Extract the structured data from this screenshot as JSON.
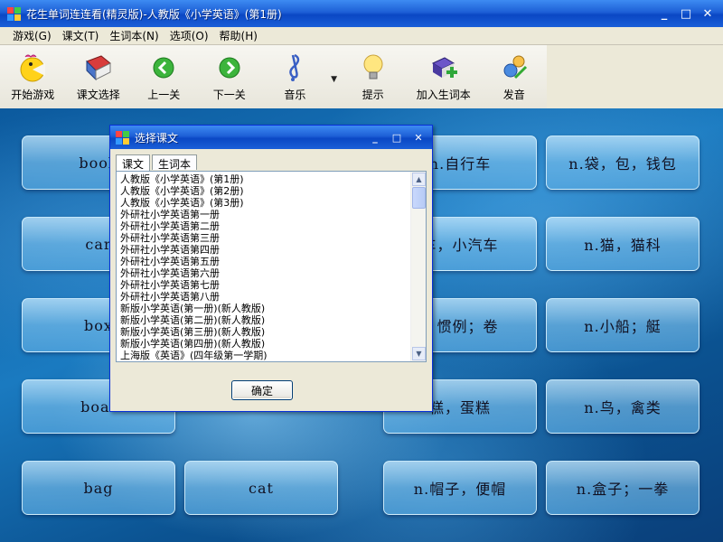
{
  "window": {
    "title": "花生单词连连看(精灵版)-人教版《小学英语》(第1册)",
    "buttons": [
      "_",
      "□",
      "✕"
    ]
  },
  "menu": [
    {
      "label": "游戏(G)"
    },
    {
      "label": "课文(T)"
    },
    {
      "label": "生词本(N)"
    },
    {
      "label": "选项(O)"
    },
    {
      "label": "帮助(H)"
    }
  ],
  "toolbar": [
    {
      "label": "开始游戏",
      "icon": "pacman-icon"
    },
    {
      "label": "课文选择",
      "icon": "book-icon"
    },
    {
      "label": "上一关",
      "icon": "arrow-left-icon"
    },
    {
      "label": "下一关",
      "icon": "arrow-right-icon"
    },
    {
      "label": "音乐",
      "icon": "music-note-icon"
    },
    {
      "label": "提示",
      "icon": "lightbulb-icon"
    },
    {
      "label": "加入生词本",
      "icon": "add-book-icon"
    },
    {
      "label": "发音",
      "icon": "speaker-person-icon"
    }
  ],
  "cards": [
    {
      "text": "book"
    },
    {
      "text": "n.自行车"
    },
    {
      "text": "n.袋，包，钱包"
    },
    {
      "text": "car"
    },
    {
      "text": "车，小汽车"
    },
    {
      "text": "n.猫，猫科"
    },
    {
      "text": "box"
    },
    {
      "text": "；惯例；卷"
    },
    {
      "text": "n.小船；艇"
    },
    {
      "text": "boat"
    },
    {
      "text": "糕，蛋糕"
    },
    {
      "text": "n.鸟，禽类"
    },
    {
      "text": "bag"
    },
    {
      "text": "cat"
    },
    {
      "text": "n.帽子，便帽"
    },
    {
      "text": "n.盒子；一拳"
    }
  ],
  "dialog": {
    "title": "选择课文",
    "tabs": [
      {
        "label": "课文"
      },
      {
        "label": "生词本"
      }
    ],
    "list": [
      "人教版《小学英语》(第1册)",
      "人教版《小学英语》(第2册)",
      "人教版《小学英语》(第3册)",
      "外研社小学英语第一册",
      "外研社小学英语第二册",
      "外研社小学英语第三册",
      "外研社小学英语第四册",
      "外研社小学英语第五册",
      "外研社小学英语第六册",
      "外研社小学英语第七册",
      "外研社小学英语第八册",
      "新版小学英语(第一册)(新人教版)",
      "新版小学英语(第二册)(新人教版)",
      "新版小学英语(第三册)(新人教版)",
      "新版小学英语(第四册)(新人教版)",
      "上海版《英语》(四年级第一学期)"
    ],
    "ok_label": "确定",
    "buttons": [
      "_",
      "□",
      "✕"
    ]
  },
  "colors": {
    "titlebar": "#1d5fd6",
    "water": "#1a7ac0",
    "card": "#9bd0f0"
  }
}
